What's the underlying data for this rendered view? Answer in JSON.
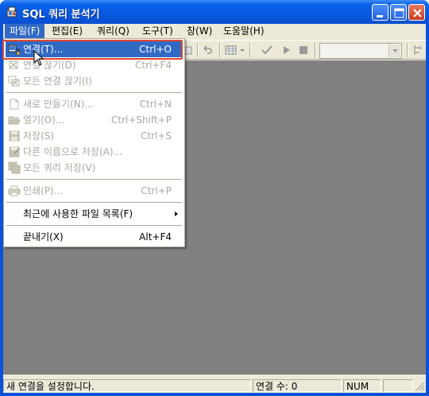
{
  "window": {
    "title": "SQL 쿼리 분석기",
    "controls": [
      "minimize",
      "maximize",
      "close"
    ]
  },
  "menubar": {
    "items": [
      {
        "label": "파일(F)",
        "active": true
      },
      {
        "label": "편집(E)",
        "active": false
      },
      {
        "label": "쿼리(Q)",
        "active": false
      },
      {
        "label": "도구(T)",
        "active": false
      },
      {
        "label": "창(W)",
        "active": false
      },
      {
        "label": "도움말(H)",
        "active": false
      }
    ]
  },
  "toolbar": {
    "icons": [
      "undo-icon",
      "grid-results-icon",
      "check-syntax-icon",
      "execute-icon",
      "stop-icon",
      "object-browser-icon"
    ],
    "database_value": ""
  },
  "file_menu": {
    "items": [
      {
        "label": "연결(T)...",
        "shortcut": "Ctrl+O",
        "icon": "connect-icon",
        "disabled": false,
        "highlighted": true
      },
      {
        "label": "연결 끊기(D)",
        "shortcut": "Ctrl+F4",
        "icon": "disconnect-icon",
        "disabled": true
      },
      {
        "label": "모든 연결 끊기(I)",
        "shortcut": "",
        "icon": "disconnect-all-icon",
        "disabled": true
      },
      {
        "label": "새로 만들기(N)...",
        "shortcut": "Ctrl+N",
        "icon": "new-file-icon",
        "disabled": true
      },
      {
        "label": "열기(O)...",
        "shortcut": "Ctrl+Shift+P",
        "icon": "open-folder-icon",
        "disabled": true
      },
      {
        "label": "저장(S)",
        "shortcut": "Ctrl+S",
        "icon": "save-icon",
        "disabled": true
      },
      {
        "label": "다른 이름으로 저장(A)...",
        "shortcut": "",
        "icon": "save-as-icon",
        "disabled": true
      },
      {
        "label": "모든 쿼리 저장(V)",
        "shortcut": "",
        "icon": "save-all-icon",
        "disabled": true
      },
      {
        "label": "인쇄(P)...",
        "shortcut": "Ctrl+P",
        "icon": "print-icon",
        "disabled": true
      },
      {
        "label": "최근에 사용한 파일 목록(F)",
        "shortcut": "",
        "icon": "",
        "disabled": false,
        "submenu": true
      },
      {
        "label": "끝내기(X)",
        "shortcut": "Alt+F4",
        "icon": "",
        "disabled": false
      }
    ]
  },
  "statusbar": {
    "message": "새 연결을 설정합니다.",
    "connections": "연결 수: 0",
    "numlock": "NUM"
  },
  "colors": {
    "titlebar": "#0a52dc",
    "menu_highlight": "#316ac5",
    "mdi_background": "#808080",
    "focus_ring": "#e8452a"
  }
}
